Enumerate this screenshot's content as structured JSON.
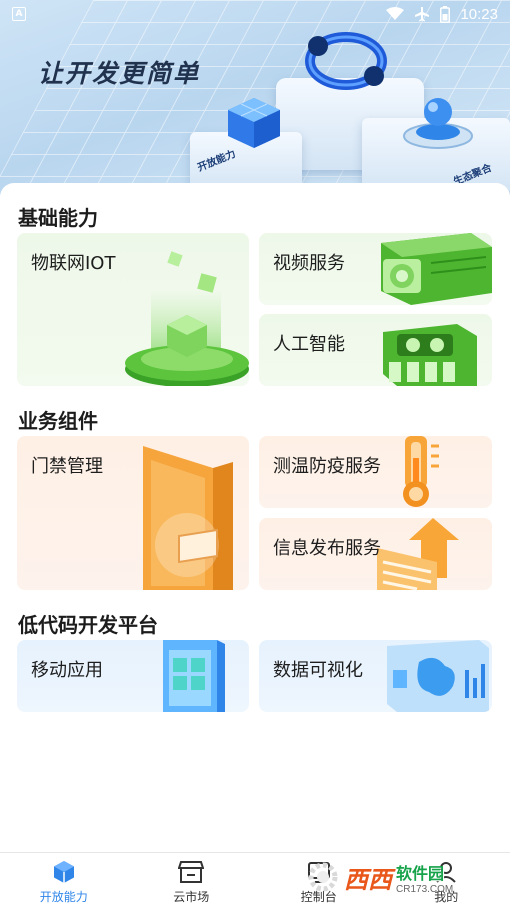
{
  "status_bar": {
    "time": "10:23",
    "icons": [
      "app-notification-icon",
      "wifi-icon",
      "airplane-mode-icon",
      "battery-icon"
    ]
  },
  "banner": {
    "title": "让开发更简单",
    "label_left": "开放能力",
    "label_right": "生态聚合"
  },
  "sections": [
    {
      "title": "基础能力",
      "cards": [
        {
          "label": "物联网IOT",
          "theme": "green"
        },
        {
          "label": "视频服务",
          "theme": "green"
        },
        {
          "label": "人工智能",
          "theme": "green"
        }
      ]
    },
    {
      "title": "业务组件",
      "cards": [
        {
          "label": "门禁管理",
          "theme": "orange"
        },
        {
          "label": "测温防疫服务",
          "theme": "orange"
        },
        {
          "label": "信息发布服务",
          "theme": "orange"
        }
      ]
    },
    {
      "title": "低代码开发平台",
      "cards": [
        {
          "label": "移动应用",
          "theme": "blue"
        },
        {
          "label": "数据可视化",
          "theme": "blue"
        }
      ]
    }
  ],
  "bottom_nav": [
    {
      "label": "开放能力",
      "icon": "cube-icon",
      "active": true
    },
    {
      "label": "云市场",
      "icon": "store-icon",
      "active": false
    },
    {
      "label": "控制台",
      "icon": "console-icon",
      "active": false
    },
    {
      "label": "我的",
      "icon": "user-icon",
      "active": false
    }
  ],
  "watermark": {
    "logo": "西西",
    "title": "软件园",
    "url": "CR173.COM"
  },
  "colors": {
    "accent": "#2f86e8",
    "green_card": "#eef8e9",
    "orange_card": "#fff0e6",
    "blue_card": "#e6f2fd"
  }
}
